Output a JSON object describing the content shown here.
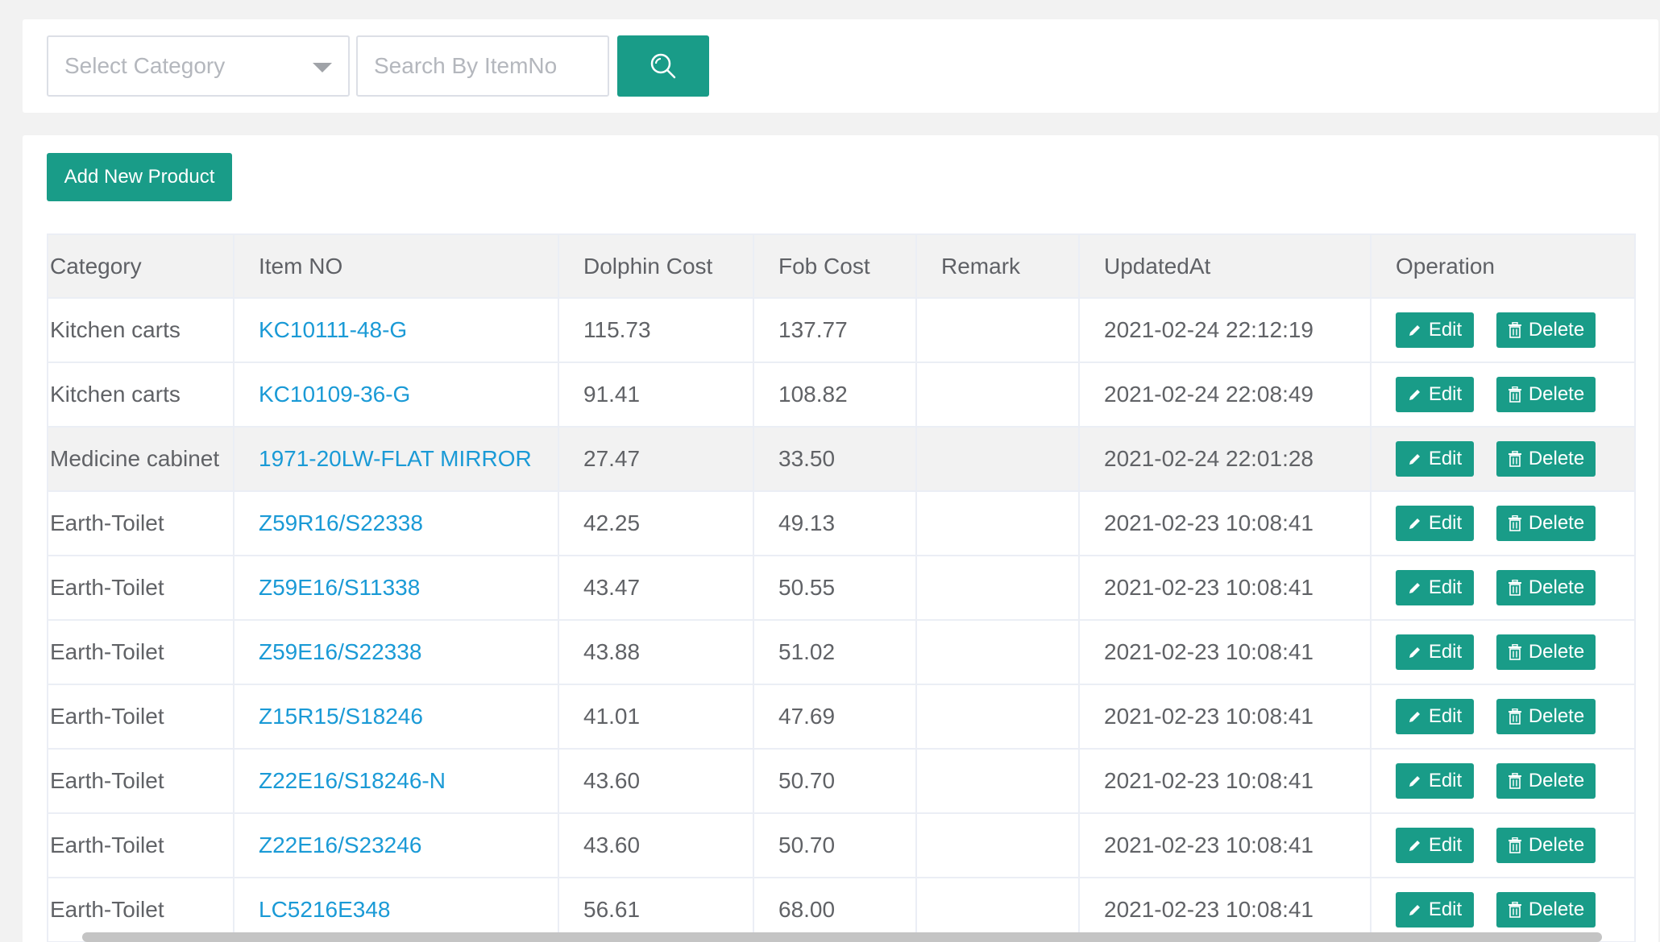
{
  "search": {
    "category_placeholder": "Select Category",
    "item_placeholder": "Search By ItemNo",
    "search_icon": "search-icon"
  },
  "toolbar": {
    "add_label": "Add New Product"
  },
  "table": {
    "columns": [
      "Category",
      "Item NO",
      "Dolphin Cost",
      "Fob Cost",
      "Remark",
      "UpdatedAt",
      "Operation"
    ],
    "rows": [
      {
        "category": "Kitchen carts",
        "item_no": "KC10111-48-G",
        "dolphin_cost": "115.73",
        "fob_cost": "137.77",
        "remark": "",
        "updated_at": "2021-02-24 22:12:19"
      },
      {
        "category": "Kitchen carts",
        "item_no": "KC10109-36-G",
        "dolphin_cost": "91.41",
        "fob_cost": "108.82",
        "remark": "",
        "updated_at": "2021-02-24 22:08:49"
      },
      {
        "category": "Medicine cabinet",
        "item_no": "1971-20LW-FLAT MIRROR",
        "dolphin_cost": "27.47",
        "fob_cost": "33.50",
        "remark": "",
        "updated_at": "2021-02-24 22:01:28"
      },
      {
        "category": "Earth-Toilet",
        "item_no": "Z59R16/S22338",
        "dolphin_cost": "42.25",
        "fob_cost": "49.13",
        "remark": "",
        "updated_at": "2021-02-23 10:08:41"
      },
      {
        "category": "Earth-Toilet",
        "item_no": "Z59E16/S11338",
        "dolphin_cost": "43.47",
        "fob_cost": "50.55",
        "remark": "",
        "updated_at": "2021-02-23 10:08:41"
      },
      {
        "category": "Earth-Toilet",
        "item_no": "Z59E16/S22338",
        "dolphin_cost": "43.88",
        "fob_cost": "51.02",
        "remark": "",
        "updated_at": "2021-02-23 10:08:41"
      },
      {
        "category": "Earth-Toilet",
        "item_no": "Z15R15/S18246",
        "dolphin_cost": "41.01",
        "fob_cost": "47.69",
        "remark": "",
        "updated_at": "2021-02-23 10:08:41"
      },
      {
        "category": "Earth-Toilet",
        "item_no": "Z22E16/S18246-N",
        "dolphin_cost": "43.60",
        "fob_cost": "50.70",
        "remark": "",
        "updated_at": "2021-02-23 10:08:41"
      },
      {
        "category": "Earth-Toilet",
        "item_no": "Z22E16/S23246",
        "dolphin_cost": "43.60",
        "fob_cost": "50.70",
        "remark": "",
        "updated_at": "2021-02-23 10:08:41"
      },
      {
        "category": "Earth-Toilet",
        "item_no": "LC5216E348",
        "dolphin_cost": "56.61",
        "fob_cost": "68.00",
        "remark": "",
        "updated_at": "2021-02-23 10:08:41"
      }
    ],
    "highlighted_row": 2,
    "edit_label": "Edit",
    "delete_label": "Delete",
    "edit_icon": "pencil-icon",
    "delete_icon": "trash-icon"
  },
  "colors": {
    "primary": "#199c88",
    "link": "#1a9ad6",
    "text": "#606266",
    "page_bg": "#f2f2f2",
    "border": "#ebeef5"
  }
}
